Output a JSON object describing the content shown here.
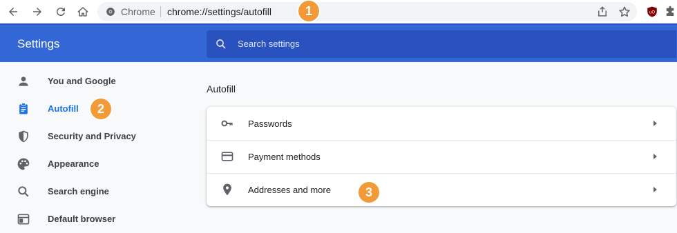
{
  "browser": {
    "site_chip": "Chrome",
    "url": "chrome://settings/autofill"
  },
  "header": {
    "title": "Settings",
    "search_placeholder": "Search settings"
  },
  "sidebar": {
    "items": [
      {
        "label": "You and Google",
        "icon": "person-icon"
      },
      {
        "label": "Autofill",
        "icon": "clipboard-icon",
        "active": true
      },
      {
        "label": "Security and Privacy",
        "icon": "shield-icon"
      },
      {
        "label": "Appearance",
        "icon": "palette-icon"
      },
      {
        "label": "Search engine",
        "icon": "search-icon"
      },
      {
        "label": "Default browser",
        "icon": "browser-window-icon"
      }
    ]
  },
  "main": {
    "section_title": "Autofill",
    "rows": [
      {
        "label": "Passwords",
        "icon": "key-icon"
      },
      {
        "label": "Payment methods",
        "icon": "credit-card-icon"
      },
      {
        "label": "Addresses and more",
        "icon": "location-pin-icon"
      }
    ]
  },
  "annotations": [
    "1",
    "2",
    "3"
  ],
  "colors": {
    "header_blue": "#3367d6",
    "active_blue": "#1a73e8",
    "badge_orange": "#f29a38"
  }
}
